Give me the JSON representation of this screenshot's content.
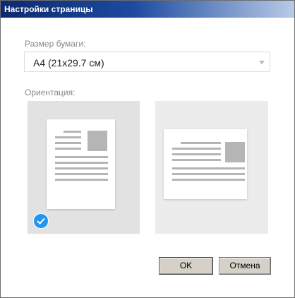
{
  "window": {
    "title": "Настройки страницы"
  },
  "paper_size": {
    "label": "Размер бумаги:",
    "selected": "A4 (21x29.7 см)"
  },
  "orientation": {
    "label": "Ориентация:",
    "options": [
      {
        "id": "portrait",
        "selected": true
      },
      {
        "id": "landscape",
        "selected": false
      }
    ]
  },
  "buttons": {
    "ok": "OK",
    "cancel": "Отмена"
  },
  "icons": {
    "selected_indicator": "checkmark-icon",
    "select_arrow": "chevron-down-icon"
  },
  "colors": {
    "titlebar_start": "#0c2a6e",
    "titlebar_end": "#b7cbe8",
    "accent_check": "#2196f3",
    "selected_card_bg": "#e2e2e2",
    "unselected_card_bg": "#ececec"
  }
}
